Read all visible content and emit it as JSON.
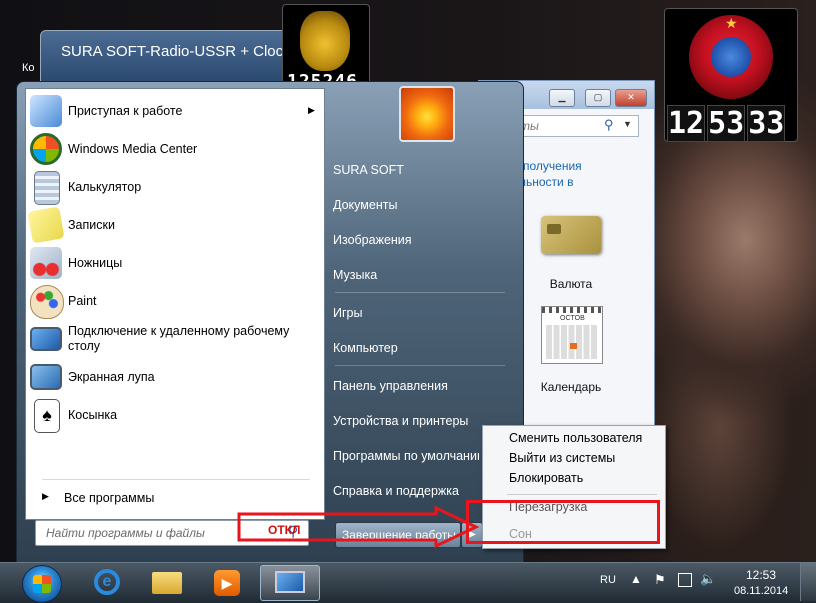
{
  "desktop": {
    "partial_label": "Ко",
    "background_window_title": "SURA SOFT-Radio-USSR + Cloc"
  },
  "clock_small": {
    "time": "125246"
  },
  "clock_large": {
    "hours": "12",
    "minutes": "53",
    "seconds": "33"
  },
  "gadget_panel": {
    "search_placeholder": "ты",
    "link_line1": "получения",
    "link_line2": "льности в",
    "gadgets": [
      {
        "name": "Валюта",
        "icon": "currency-icon"
      },
      {
        "name": "Календарь",
        "icon": "calendar-icon"
      }
    ],
    "calendar_month": "OCTOB",
    "partial_char": "и"
  },
  "start_menu": {
    "programs": [
      {
        "label": "Приступая к работе",
        "icon": "getting-started-icon",
        "has_submenu": true
      },
      {
        "label": "Windows Media Center",
        "icon": "media-center-icon"
      },
      {
        "label": "Калькулятор",
        "icon": "calculator-icon"
      },
      {
        "label": "Записки",
        "icon": "sticky-notes-icon"
      },
      {
        "label": "Ножницы",
        "icon": "scissors-icon"
      },
      {
        "label": "Paint",
        "icon": "paint-icon"
      },
      {
        "label": "Подключение к удаленному рабочему столу",
        "icon": "remote-desktop-icon"
      },
      {
        "label": "Экранная лупа",
        "icon": "magnifier-icon"
      },
      {
        "label": "Косынка",
        "icon": "solitaire-icon"
      }
    ],
    "all_programs": "Все программы",
    "search_placeholder": "Найти программы и файлы",
    "right_items": [
      "SURA SOFT",
      "Документы",
      "Изображения",
      "Музыка",
      "Игры",
      "Компьютер",
      "Панель управления",
      "Устройства и принтеры",
      "Программы по умолчанию",
      "Справка и поддержка"
    ],
    "shutdown_label": "Завершение работы"
  },
  "shutdown_menu": {
    "items": [
      "Сменить пользователя",
      "Выйти из системы",
      "Блокировать"
    ],
    "restart": "Перезагрузка",
    "sleep": "Сон"
  },
  "annotation": {
    "arrow_text": "ОТКЛ",
    "color": "#e8151d"
  },
  "taskbar": {
    "language": "RU",
    "time": "12:53",
    "date": "08.11.2014",
    "pinned": [
      "internet-explorer-icon",
      "explorer-folder-icon",
      "media-player-icon",
      "remote-app-icon"
    ]
  }
}
